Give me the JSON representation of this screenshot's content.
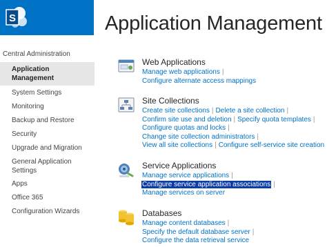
{
  "page_title": "Application Management",
  "nav": {
    "header": "Central Administration",
    "items": [
      {
        "label": "Application Management",
        "selected": true
      },
      {
        "label": "System Settings"
      },
      {
        "label": "Monitoring"
      },
      {
        "label": "Backup and Restore"
      },
      {
        "label": "Security"
      },
      {
        "label": "Upgrade and Migration"
      },
      {
        "label": "General Application Settings"
      },
      {
        "label": "Apps"
      },
      {
        "label": "Office 365"
      },
      {
        "label": "Configuration Wizards"
      }
    ]
  },
  "sections": [
    {
      "heading": "Web Applications",
      "icon": "web-applications-icon",
      "rows": [
        [
          "Manage web applications"
        ],
        [
          "Configure alternate access mappings"
        ]
      ]
    },
    {
      "heading": "Site Collections",
      "icon": "site-collections-icon",
      "rows": [
        [
          "Create site collections",
          "Delete a site collection"
        ],
        [
          "Confirm site use and deletion",
          "Specify quota templates"
        ],
        [
          "Configure quotas and locks"
        ],
        [
          "Change site collection administrators"
        ],
        [
          "View all site collections",
          "Configure self-service site creation"
        ]
      ]
    },
    {
      "heading": "Service Applications",
      "icon": "service-applications-icon",
      "rows": [
        [
          "Manage service applications"
        ],
        [
          "Configure service application associations"
        ],
        [
          "Manage services on server"
        ]
      ],
      "highlighted": "Configure service application associations"
    },
    {
      "heading": "Databases",
      "icon": "databases-icon",
      "rows": [
        [
          "Manage content databases"
        ],
        [
          "Specify the default database server"
        ],
        [
          "Configure the data retrieval service"
        ]
      ]
    }
  ],
  "colors": {
    "brand": "#0072c6",
    "link": "#0072c6",
    "selection_highlight": "#0a3da8",
    "nav_selected_bg": "#e6e6e6"
  }
}
